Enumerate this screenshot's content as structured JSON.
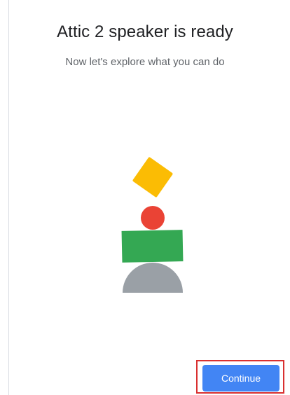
{
  "header": {
    "title": "Attic 2 speaker is ready",
    "subtitle": "Now let's explore what you can do"
  },
  "illustration": {
    "shapes": [
      {
        "name": "diamond",
        "color": "#fbbc04"
      },
      {
        "name": "circle",
        "color": "#ea4335"
      },
      {
        "name": "rectangle",
        "color": "#34a853"
      },
      {
        "name": "half-dome",
        "color": "#9aa0a6"
      }
    ]
  },
  "footer": {
    "continue_label": "Continue",
    "continue_color": "#4285f4"
  },
  "highlight": {
    "target": "continue-button",
    "color": "#d93030"
  }
}
